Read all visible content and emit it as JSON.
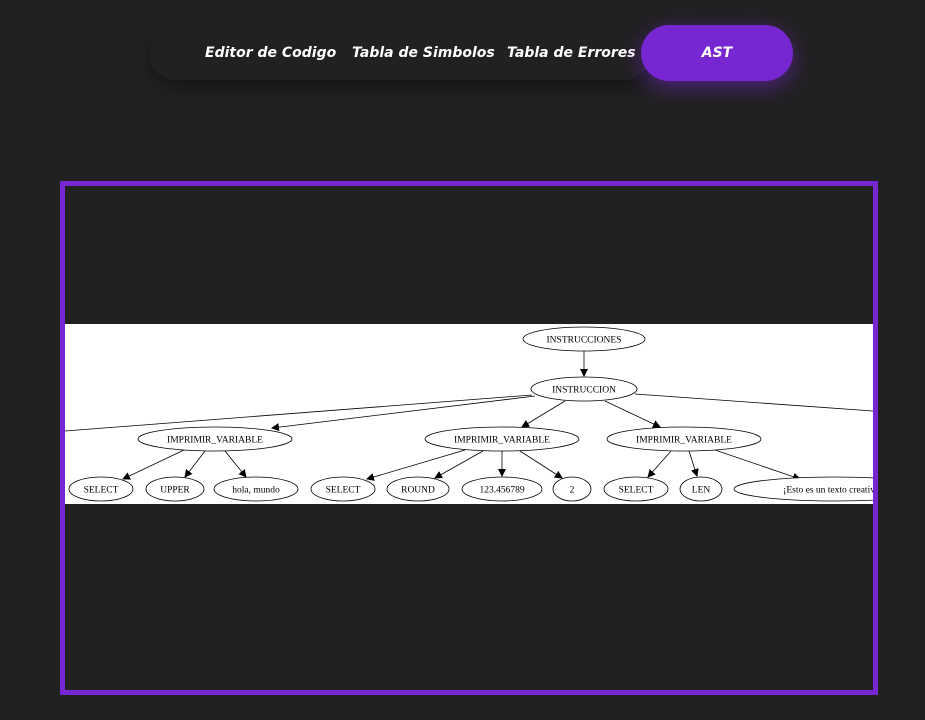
{
  "nav": {
    "editor": "Editor de Codigo",
    "simbolos": "Tabla de Simbolos",
    "errores": "Tabla de Errores",
    "ast": "AST"
  },
  "colors": {
    "background": "#212121",
    "accent": "#7727d1",
    "text": "#ffffff"
  },
  "ast": {
    "root": "INSTRUCCIONES",
    "instruccion": "INSTRUCCION",
    "imprimir_1": "IMPRIMIR_VARIABLE",
    "imprimir_2": "IMPRIMIR_VARIABLE",
    "imprimir_3": "IMPRIMIR_VARIABLE",
    "select_1": "SELECT",
    "upper": "UPPER",
    "hola_mundo": "hola, mundo",
    "select_2": "SELECT",
    "round": "ROUND",
    "num_123": "123.456789",
    "num_2": "2",
    "select_3": "SELECT",
    "len": "LEN",
    "texto_creativo": "¡Esto es un texto creativo y"
  }
}
